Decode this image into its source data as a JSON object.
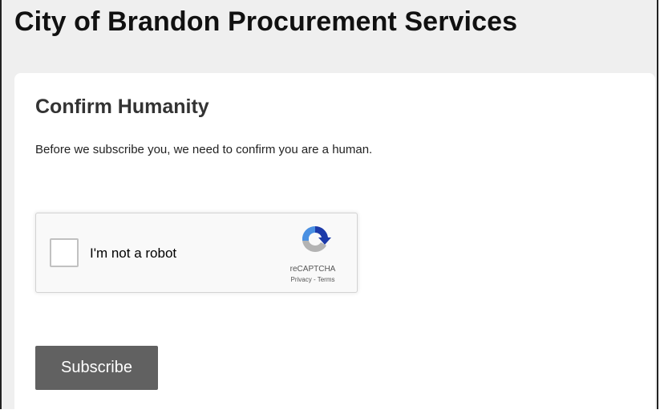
{
  "header": {
    "title": "City of Brandon Procurement Services"
  },
  "card": {
    "title": "Confirm Humanity",
    "description": "Before we subscribe you, we need to confirm you are a human."
  },
  "recaptcha": {
    "checkbox_label": "I'm not a robot",
    "brand": "reCAPTCHA",
    "privacy_link": "Privacy",
    "separator": " - ",
    "terms_link": "Terms",
    "checked": false,
    "logo_icon": "recaptcha-logo-icon",
    "colors": {
      "logo_blue_dark": "#1c3aa9",
      "logo_blue": "#4a90e2",
      "logo_gray": "#b3b3b3"
    }
  },
  "actions": {
    "subscribe_label": "Subscribe",
    "subscribe_color": "#616161"
  },
  "colors": {
    "page_background": "#efefef",
    "card_background": "#ffffff"
  }
}
